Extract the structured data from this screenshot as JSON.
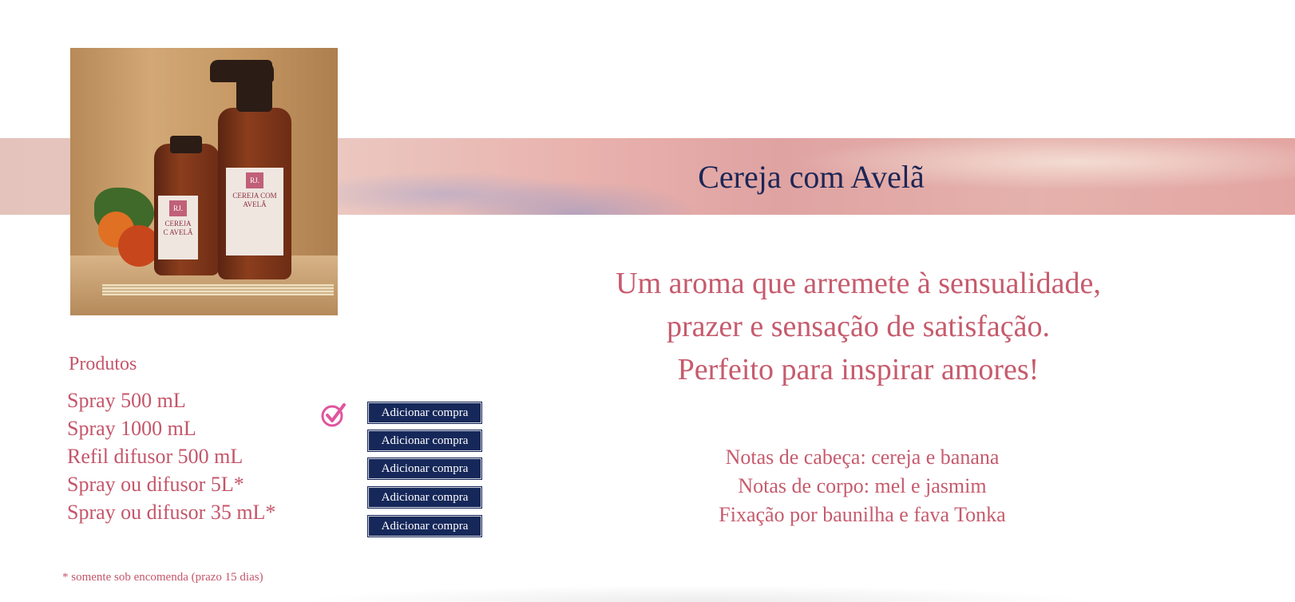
{
  "banner": {
    "title": "Cereja com Avelã"
  },
  "product_image": {
    "alt": "Cereja com Avelã",
    "label_small_lines": [
      "CEREJA",
      "C AVELÃ"
    ],
    "label_big_text": "CEREJA COM AVELÃ",
    "brand": "RJ."
  },
  "products": {
    "heading": "Produtos",
    "button_label": "Adicionar compra",
    "items": [
      {
        "name": "Spray 500 mL",
        "selected": true
      },
      {
        "name": "Spray 1000 mL",
        "selected": false
      },
      {
        "name": "Refil difusor 500 mL",
        "selected": false
      },
      {
        "name": "Spray ou difusor 5L*",
        "selected": false
      },
      {
        "name": "Spray ou difusor 35 mL*",
        "selected": false
      }
    ],
    "footnote": "* somente sob encomenda (prazo 15 dias)"
  },
  "description": {
    "tagline_lines": [
      "Um aroma que arremete à sensualidade,",
      "prazer e sensação de satisfação.",
      "Perfeito para inspirar amores!"
    ],
    "notes": [
      "Notas de cabeça: cereja e banana",
      "Notas de corpo: mel e jasmim",
      "Fixação por baunilha e fava Tonka"
    ]
  },
  "colors": {
    "accent_text": "#c65b6d",
    "button_bg": "#16285a",
    "title_text": "#1c2656",
    "check_icon": "#e0559e"
  },
  "icons": {
    "selected": "checkmark-circle-icon"
  }
}
